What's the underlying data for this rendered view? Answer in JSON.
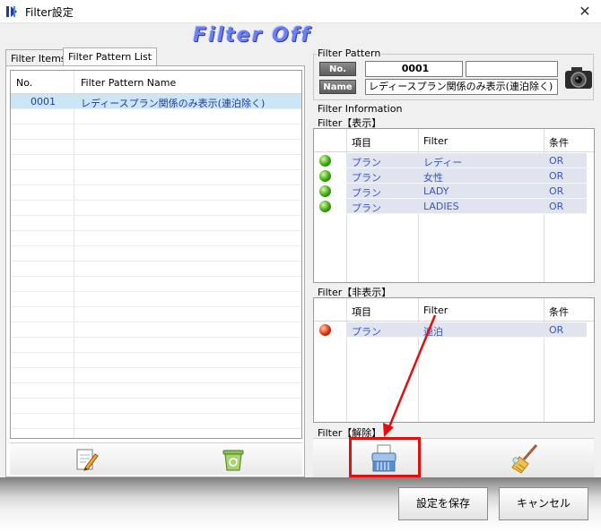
{
  "window": {
    "title": "Filter設定",
    "close_label": "✕"
  },
  "banner": {
    "text": "Filter Off"
  },
  "tabs": [
    {
      "label": "Filter Items"
    },
    {
      "label": "Filter Pattern List"
    }
  ],
  "pattern_list": {
    "columns": [
      "No.",
      "Filter Pattern Name"
    ],
    "rows": [
      {
        "no": "0001",
        "name": "レディースプラン関係のみ表示(連泊除く)"
      }
    ]
  },
  "filter_pattern": {
    "section_label": "Filter Pattern",
    "no_badge": "No.",
    "name_badge": "Name",
    "no_value": "0001",
    "extra_value": "",
    "name_value": "レディースプラン関係のみ表示(連泊除く)"
  },
  "filter_information": {
    "section_label": "Filter Information",
    "show": {
      "label": "Filter【表示】",
      "columns": [
        "項目",
        "Filter",
        "条件"
      ],
      "rows": [
        {
          "item": "プラン",
          "filter": "レディー",
          "cond": "OR"
        },
        {
          "item": "プラン",
          "filter": "女性",
          "cond": "OR"
        },
        {
          "item": "プラン",
          "filter": "LADY",
          "cond": "OR"
        },
        {
          "item": "プラン",
          "filter": "LADIES",
          "cond": "OR"
        }
      ]
    },
    "hide": {
      "label": "Filter【非表示】",
      "columns": [
        "項目",
        "Filter",
        "条件"
      ],
      "rows": [
        {
          "item": "プラン",
          "filter": "連泊",
          "cond": "OR"
        }
      ]
    },
    "release": {
      "label": "Filter【解除】"
    }
  },
  "buttons": {
    "save": "設定を保存",
    "cancel": "キャンセル"
  },
  "colors": {
    "accent_red": "#e01010",
    "selection": "#cde6f7",
    "row_fill": "#dfe4ef"
  }
}
